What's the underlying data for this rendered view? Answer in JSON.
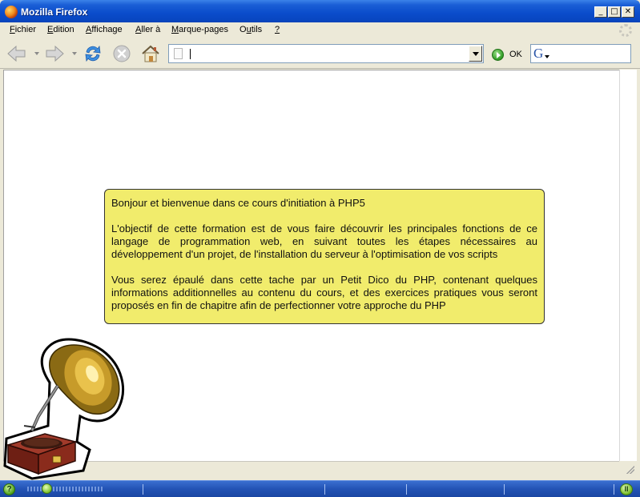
{
  "window": {
    "title": "Mozilla Firefox",
    "controls": {
      "minimize": "_",
      "maximize": "□",
      "close": "✕"
    }
  },
  "menu": {
    "items": [
      {
        "label": "Fichier",
        "underline_index": 0
      },
      {
        "label": "Edition",
        "underline_index": 0
      },
      {
        "label": "Affichage",
        "underline_index": 0
      },
      {
        "label": "Aller à",
        "underline_index": 0
      },
      {
        "label": "Marque-pages",
        "underline_index": 0
      },
      {
        "label": "Outils",
        "underline_index": 1
      },
      {
        "label": "?",
        "underline_index": 0
      }
    ]
  },
  "toolbar": {
    "icons": [
      "back-icon",
      "forward-icon",
      "reload-icon",
      "stop-icon",
      "home-icon"
    ],
    "url_value": "",
    "go_label": "OK",
    "search_engine_glyph": "G",
    "search_value": ""
  },
  "content": {
    "box": {
      "background": "#f1ec6c",
      "greeting": "Bonjour et bienvenue dans ce cours d'initiation à PHP5",
      "paragraph1": "L'objectif de cette formation est de vous faire découvrir les principales fonctions de ce langage de programmation web, en suivant toutes les étapes nécessaires au développement d'un projet, de l'installation du serveur à l'optimisation de vos scripts",
      "paragraph2": "Vous serez épaulé dans cette tache par un Petit Dico du PHP, contenant quelques informations additionnelles au contenu du cours, et des exercices pratiques vous seront proposés en fin de chapitre afin de perfectionner votre approche du PHP"
    },
    "illustration": "gramophone-image"
  },
  "statusbar": {
    "help_glyph": "?",
    "pause_glyph": "II",
    "colors": {
      "bar": "#2353b5",
      "accent": "#7cc02b"
    }
  }
}
